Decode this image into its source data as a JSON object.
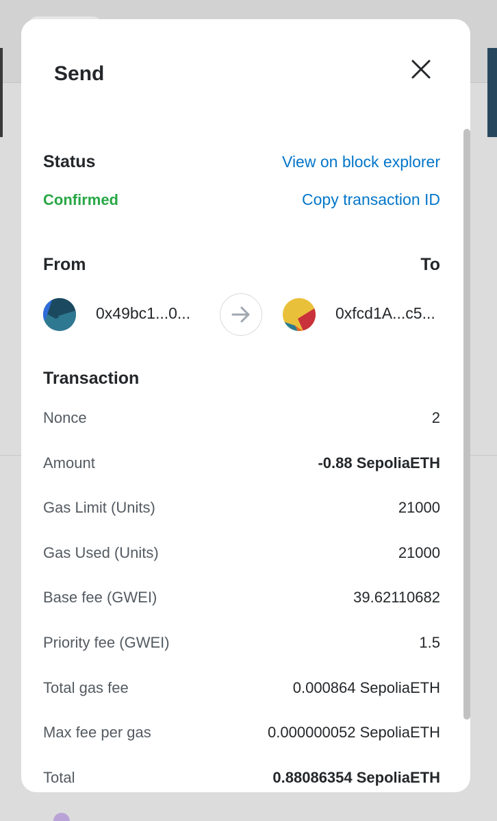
{
  "modal": {
    "title": "Send"
  },
  "status": {
    "heading": "Status",
    "value": "Confirmed",
    "view_link": "View on block explorer",
    "copy_link": "Copy transaction ID",
    "value_color": "#28a745"
  },
  "addresses": {
    "from_label": "From",
    "to_label": "To",
    "from_address": "0x49bc1...0...",
    "to_address": "0xfcd1A...c5..."
  },
  "transaction": {
    "heading": "Transaction",
    "rows": [
      {
        "label": "Nonce",
        "value": "2"
      },
      {
        "label": "Amount",
        "value": "-0.88 SepoliaETH"
      },
      {
        "label": "Gas Limit (Units)",
        "value": "21000"
      },
      {
        "label": "Gas Used (Units)",
        "value": "21000"
      },
      {
        "label": "Base fee (GWEI)",
        "value": "39.62110682"
      },
      {
        "label": "Priority fee (GWEI)",
        "value": "1.5"
      },
      {
        "label": "Total gas fee",
        "value": "0.000864 SepoliaETH"
      },
      {
        "label": "Max fee per gas",
        "value": "0.000000052 SepoliaETH"
      },
      {
        "label": "Total",
        "value": "0.88086354 SepoliaETH"
      }
    ]
  },
  "icons": {
    "close": "close-icon",
    "arrow": "arrow-right-icon",
    "from_avatar": "jazzicon-avatar",
    "to_avatar": "jazzicon-avatar"
  },
  "colors": {
    "link": "#0376c9",
    "confirmed": "#28a745",
    "text": "#24272a",
    "muted": "#535a61"
  }
}
